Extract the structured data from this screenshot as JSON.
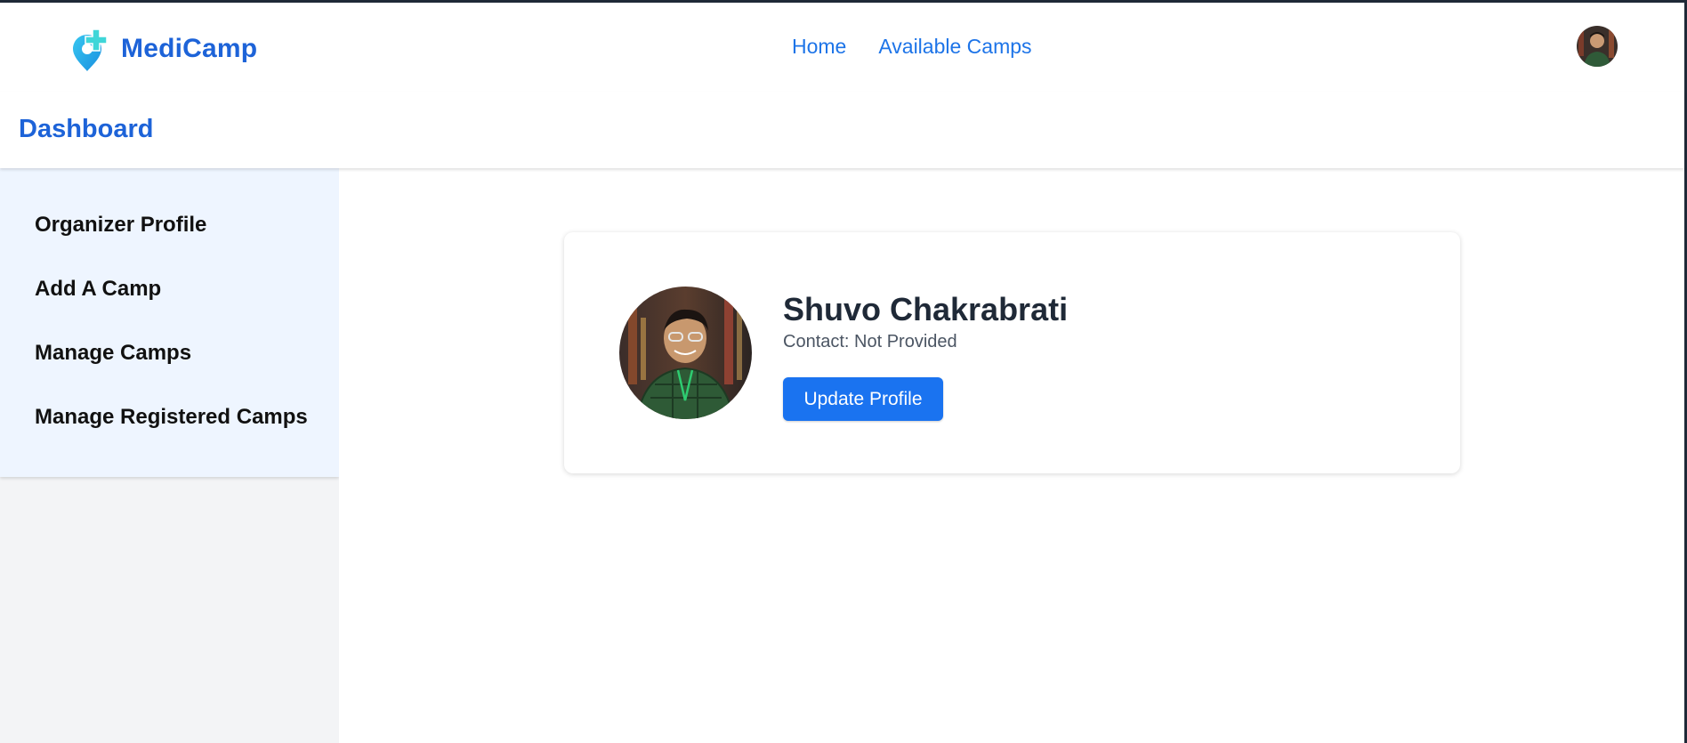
{
  "brand": {
    "name": "MediCamp",
    "icon": "medical-location-pin-icon",
    "color": "#1d63d8"
  },
  "nav": {
    "links": [
      {
        "label": "Home"
      },
      {
        "label": "Available Camps"
      }
    ],
    "avatar_icon": "user-avatar"
  },
  "dashboard": {
    "title": "Dashboard"
  },
  "sidebar": {
    "items": [
      {
        "label": "Organizer Profile"
      },
      {
        "label": "Add A Camp"
      },
      {
        "label": "Manage Camps"
      },
      {
        "label": "Manage Registered Camps"
      }
    ]
  },
  "profile": {
    "name": "Shuvo Chakrabrati",
    "contact": "Contact: Not Provided",
    "update_label": "Update Profile",
    "avatar_icon": "profile-photo"
  },
  "colors": {
    "accent": "#1a73f0",
    "link": "#1d74e8",
    "sidebar_active_bg": "#eef5ff",
    "sidebar_bg": "#f3f4f6"
  }
}
